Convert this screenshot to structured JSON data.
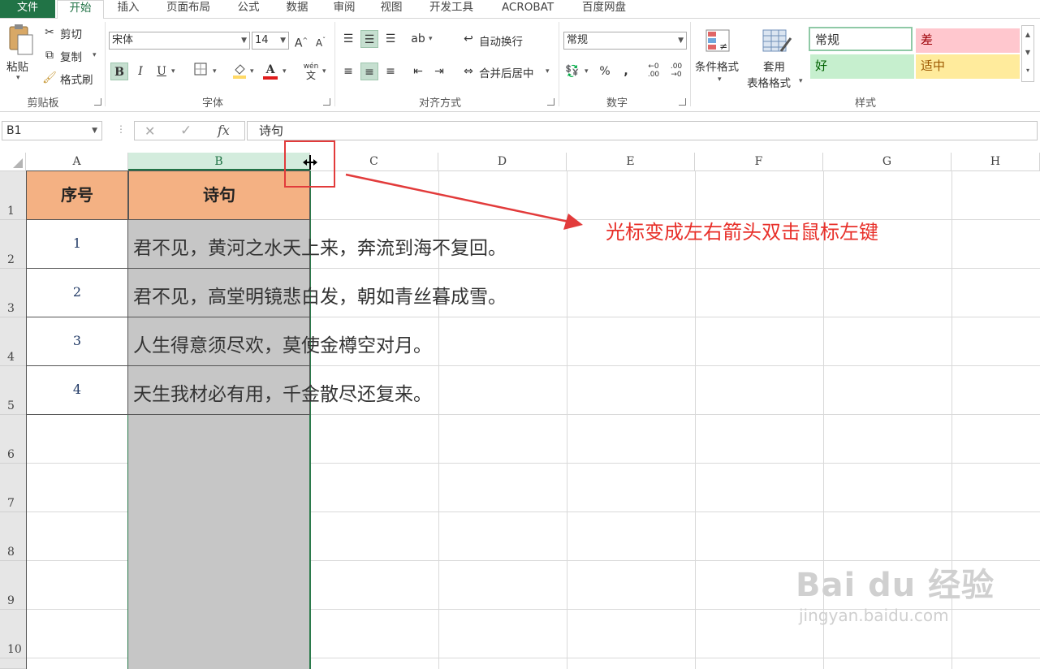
{
  "ribbon_tabs": {
    "file": "文件",
    "tabs": [
      "开始",
      "插入",
      "页面布局",
      "公式",
      "数据",
      "审阅",
      "视图",
      "开发工具",
      "ACROBAT",
      "百度网盘"
    ],
    "active": "开始"
  },
  "clipboard": {
    "paste": "粘贴",
    "cut": "剪切",
    "copy": "复制",
    "format_painter": "格式刷",
    "label": "剪贴板"
  },
  "font": {
    "name": "宋体",
    "size": "14",
    "bold": "B",
    "italic": "I",
    "underline": "U",
    "label": "字体",
    "phonetic_top": "wén",
    "phonetic_bottom": "文"
  },
  "alignment": {
    "wrap_text": "自动换行",
    "merge_center": "合并后居中",
    "label": "对齐方式"
  },
  "number": {
    "format": "常规",
    "percent": "%",
    "comma": ",",
    "label": "数字"
  },
  "styles": {
    "conditional_format": "条件格式",
    "table_format_1": "套用",
    "table_format_2": "表格格式",
    "normal": "常规",
    "bad": "差",
    "good": "好",
    "neutral": "适中",
    "label": "样式",
    "colors": {
      "normal_border": "#8fc9a6",
      "bad_bg": "#ffc7ce",
      "bad_text": "#9c0006",
      "good_bg": "#c6efce",
      "good_text": "#006100",
      "neutral_bg": "#ffeb9c",
      "neutral_text": "#9c5700"
    }
  },
  "formula_bar": {
    "name_box": "B1",
    "cancel_icon": "✕",
    "enter_icon": "✓",
    "fx": "fx",
    "content": "诗句"
  },
  "columns": [
    "A",
    "B",
    "C",
    "D",
    "E",
    "F",
    "G",
    "H"
  ],
  "rows": [
    "1",
    "2",
    "3",
    "4",
    "5",
    "6",
    "7",
    "8",
    "9",
    "10"
  ],
  "table": {
    "headers": [
      "序号",
      "诗句"
    ],
    "rows": [
      {
        "num": "1",
        "text": "君不见，黄河之水天上来，奔流到海不复回。"
      },
      {
        "num": "2",
        "text": "君不见，高堂明镜悲白发，朝如青丝暮成雪。"
      },
      {
        "num": "3",
        "text": "人生得意须尽欢，莫使金樽空对月。"
      },
      {
        "num": "4",
        "text": "天生我材必有用，千金散尽还复来。"
      }
    ],
    "header_color": "#f4b183",
    "selection_color": "#c6c6c6"
  },
  "annotation": {
    "text": "光标变成左右箭头双击鼠标左键",
    "color": "#e8302a"
  },
  "watermark": {
    "logo": "Bai du 经验",
    "url": "jingyan.baidu.com"
  },
  "accent_color": "#217346"
}
